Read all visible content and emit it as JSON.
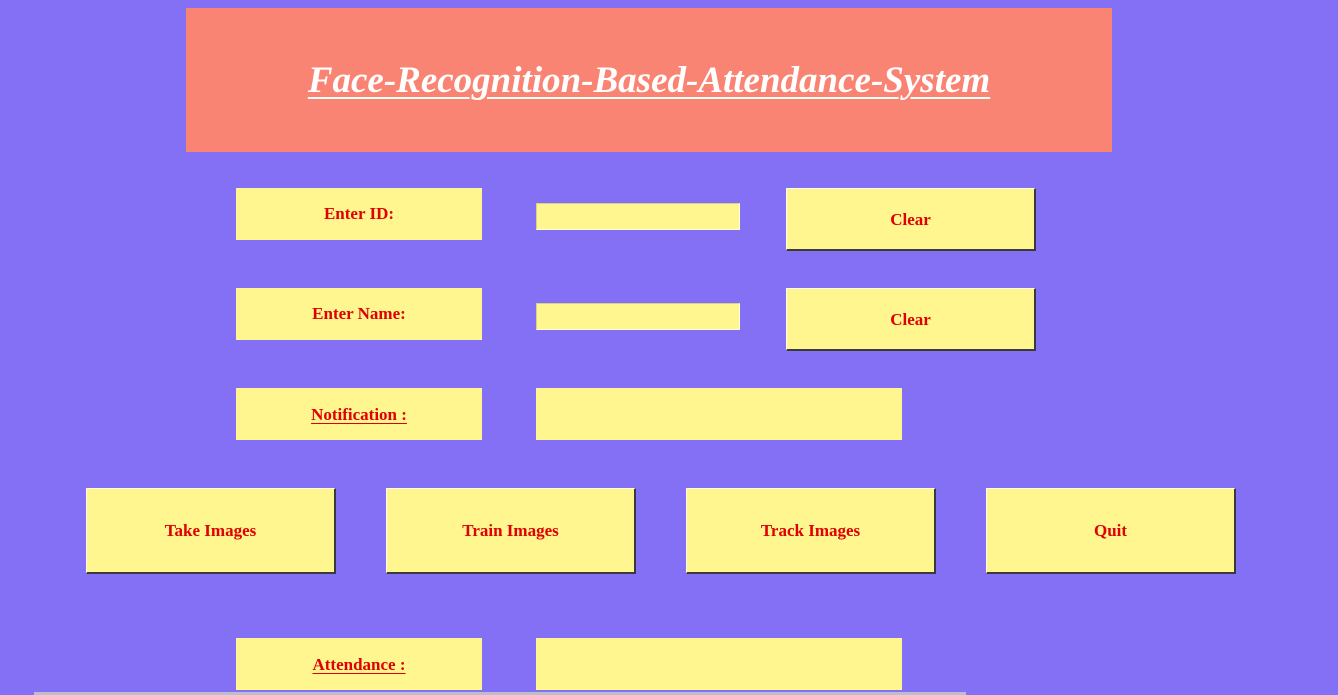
{
  "title": "Face-Recognition-Based-Attendance-System",
  "id_row": {
    "label": "Enter ID:",
    "value": "",
    "clear_label": "Clear"
  },
  "name_row": {
    "label": "Enter Name:",
    "value": "",
    "clear_label": "Clear"
  },
  "notification": {
    "label": "Notification :",
    "message": ""
  },
  "actions": {
    "take_images": "Take Images",
    "train_images": "Train Images",
    "track_images": "Track Images",
    "quit": "Quit"
  },
  "attendance": {
    "label": "Attendance :",
    "content": ""
  },
  "colors": {
    "background": "#8470f5",
    "banner": "#fa8473",
    "widget_fill": "#fff68f",
    "label_text": "#e00000",
    "title_text": "#ffffff"
  }
}
